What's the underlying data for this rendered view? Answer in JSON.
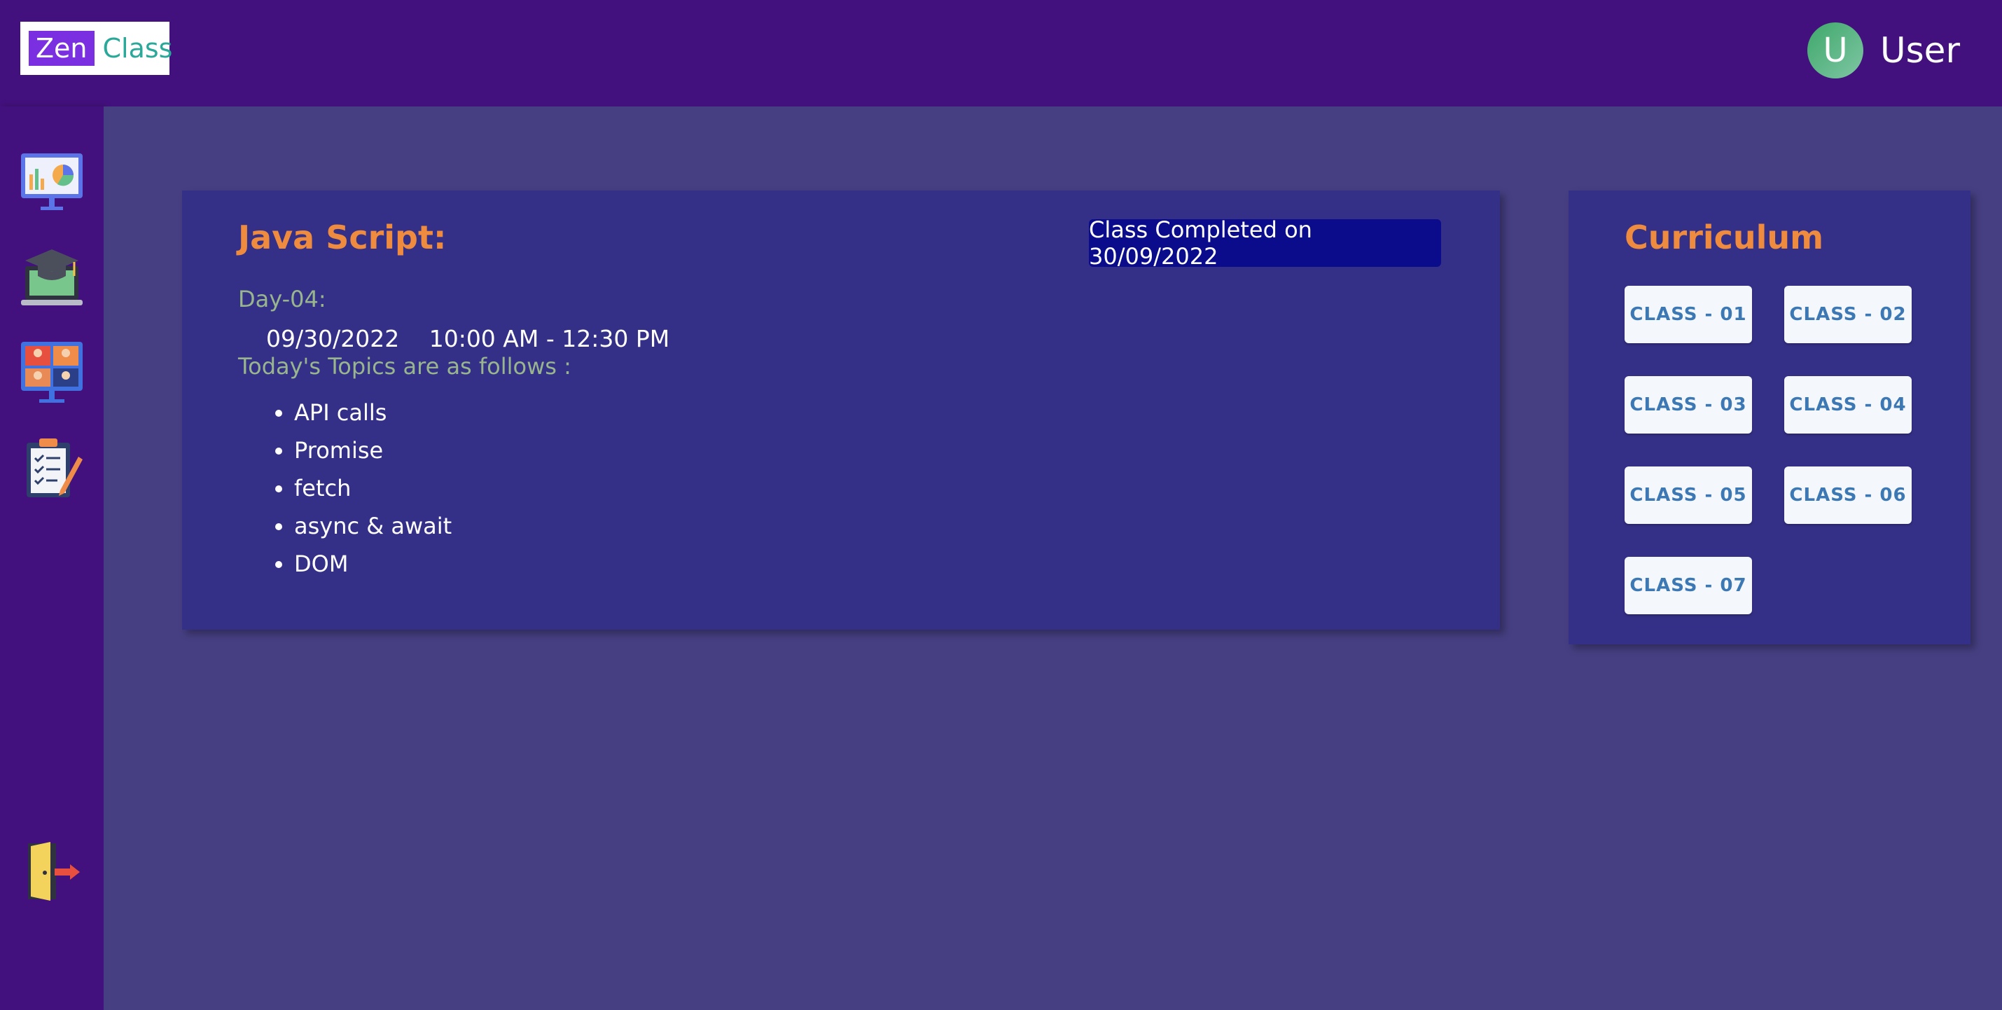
{
  "header": {
    "logo_part1": "Zen",
    "logo_part2": "Class",
    "avatar_letter": "U",
    "user_name": "User"
  },
  "sidebar": {
    "items": [
      {
        "icon": "dashboard-chart-icon"
      },
      {
        "icon": "graduation-laptop-icon"
      },
      {
        "icon": "video-meeting-icon"
      },
      {
        "icon": "tasks-clipboard-icon"
      }
    ],
    "logout_icon": "logout-door-icon"
  },
  "session": {
    "title": "Java Script:",
    "status": "Class Completed on 30/09/2022",
    "day": "Day-04:",
    "date": "09/30/2022",
    "time": "10:00 AM - 12:30 PM",
    "topics_heading": "Today's Topics are as follows :",
    "topics": [
      "API calls",
      "Promise",
      "fetch",
      "async & await",
      "DOM"
    ]
  },
  "curriculum": {
    "title": "Curriculum",
    "classes": [
      "CLASS - 01",
      "CLASS - 02",
      "CLASS - 03",
      "CLASS - 04",
      "CLASS - 05",
      "CLASS - 06",
      "CLASS - 07"
    ]
  },
  "colors": {
    "header_bg": "#43117d",
    "main_bg": "#463f82",
    "card_bg": "#353087",
    "accent_orange": "#ee8b3e",
    "badge_bg": "#0b0c8c",
    "button_text": "#3c78b4"
  }
}
